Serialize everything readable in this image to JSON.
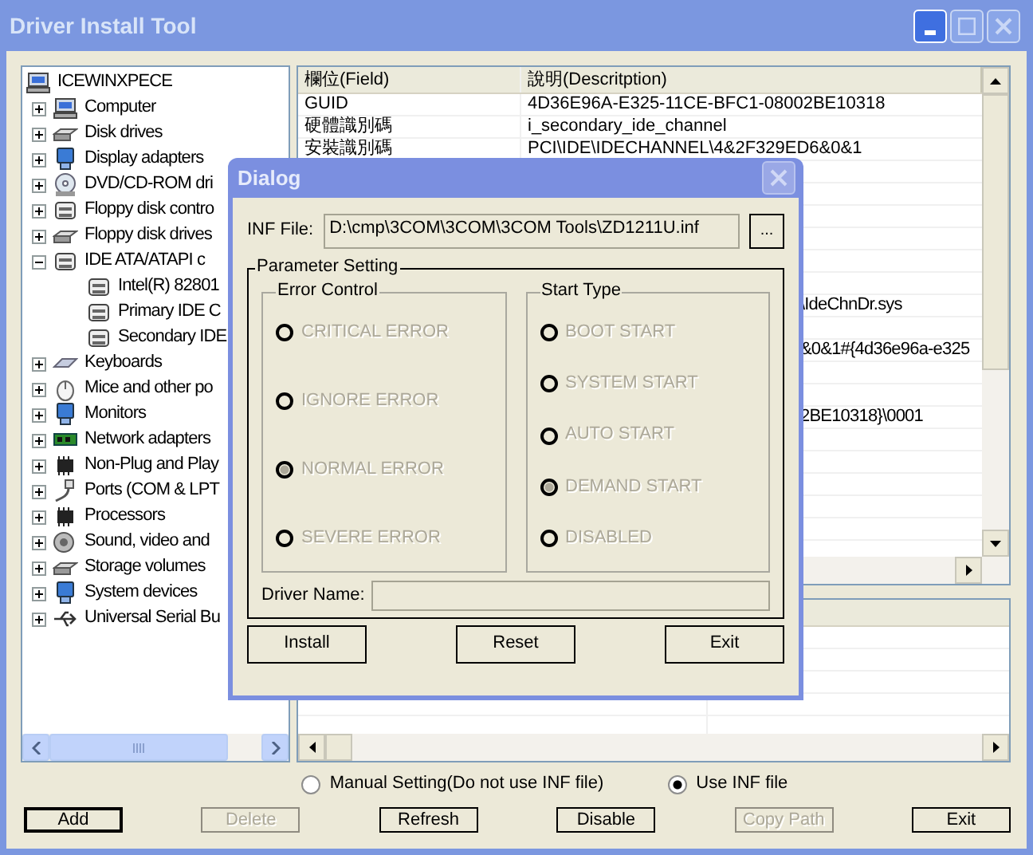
{
  "window": {
    "title": "Driver Install Tool"
  },
  "tree": {
    "label": "ICEWINXPECE",
    "kind": "computer",
    "items": [
      {
        "label": "Computer",
        "kind": "computer",
        "expanded": false
      },
      {
        "label": "Disk drives",
        "kind": "drive",
        "expanded": false
      },
      {
        "label": "Display adapters",
        "kind": "monitor",
        "expanded": false
      },
      {
        "label": "DVD/CD-ROM dri",
        "kind": "disc",
        "expanded": false
      },
      {
        "label": "Floppy disk contro",
        "kind": "controller",
        "expanded": false
      },
      {
        "label": "Floppy disk drives",
        "kind": "drive",
        "expanded": false
      },
      {
        "label": "IDE ATA/ATAPI c",
        "kind": "controller",
        "expanded": true,
        "children": [
          {
            "label": "Intel(R) 82801",
            "kind": "controller"
          },
          {
            "label": "Primary IDE C",
            "kind": "controller"
          },
          {
            "label": "Secondary IDE",
            "kind": "controller"
          }
        ]
      },
      {
        "label": "Keyboards",
        "kind": "keyboard",
        "expanded": false
      },
      {
        "label": "Mice and other po",
        "kind": "mouse",
        "expanded": false
      },
      {
        "label": "Monitors",
        "kind": "monitor",
        "expanded": false
      },
      {
        "label": "Network adapters",
        "kind": "network",
        "expanded": false
      },
      {
        "label": "Non-Plug and Play",
        "kind": "chip",
        "expanded": false
      },
      {
        "label": "Ports (COM & LPT",
        "kind": "port",
        "expanded": false
      },
      {
        "label": "Processors",
        "kind": "chip",
        "expanded": false
      },
      {
        "label": "Sound, video and",
        "kind": "sound",
        "expanded": false
      },
      {
        "label": "Storage volumes",
        "kind": "drive",
        "expanded": false
      },
      {
        "label": "System devices",
        "kind": "monitor",
        "expanded": false
      },
      {
        "label": "Universal Serial Bu",
        "kind": "usb",
        "expanded": false
      }
    ]
  },
  "properties": {
    "columns": [
      "欄位(Field)",
      "說明(Descritption)"
    ],
    "rows": [
      {
        "kind": "full",
        "field": "GUID",
        "description": "4D36E96A-E325-11CE-BFC1-08002BE10318"
      },
      {
        "kind": "full",
        "field": "硬體識別碼",
        "description": "i_secondary_ide_channel"
      },
      {
        "kind": "full",
        "field": "安裝識別碼",
        "description": "PCI\\IDE\\IDECHANNEL\\4&2F329ED6&0&1"
      },
      {
        "kind": "covered"
      },
      {
        "kind": "covered"
      },
      {
        "kind": "covered"
      },
      {
        "kind": "covered"
      },
      {
        "kind": "covered"
      },
      {
        "kind": "covered"
      },
      {
        "kind": "partial",
        "description": "\\IdeChnDr.sys"
      },
      {
        "kind": "covered"
      },
      {
        "kind": "partial",
        "description": "&0&1#{4d36e96a-e325"
      },
      {
        "kind": "covered"
      },
      {
        "kind": "covered"
      },
      {
        "kind": "partial",
        "description": "2BE10318}\\0001"
      }
    ]
  },
  "mode_options": [
    {
      "label": "Manual Setting(Do not use INF file)",
      "selected": false
    },
    {
      "label": "Use INF file",
      "selected": true
    }
  ],
  "buttons": [
    {
      "label": "Add",
      "default": true,
      "disabled": false
    },
    {
      "label": "Delete",
      "default": false,
      "disabled": true
    },
    {
      "label": "Refresh",
      "default": false,
      "disabled": false
    },
    {
      "label": "Disable",
      "default": false,
      "disabled": false
    },
    {
      "label": "Copy Path",
      "default": false,
      "disabled": true
    },
    {
      "label": "Exit",
      "default": false,
      "disabled": false
    }
  ],
  "dialog": {
    "title": "Dialog",
    "inf_label": "INF File:",
    "inf_value": "D:\\cmp\\3COM\\3COM\\3COM Tools\\ZD1211U.inf",
    "browse": "...",
    "group_title": "Parameter Setting",
    "error_control": {
      "title": "Error Control",
      "disabled": true,
      "options": [
        {
          "label": "CRITICAL ERROR",
          "selected": false
        },
        {
          "label": "IGNORE ERROR",
          "selected": false
        },
        {
          "label": "NORMAL ERROR",
          "selected": true
        },
        {
          "label": "SEVERE ERROR",
          "selected": false
        }
      ]
    },
    "start_type": {
      "title": "Start Type",
      "disabled": true,
      "options": [
        {
          "label": "BOOT START",
          "selected": false
        },
        {
          "label": "SYSTEM START",
          "selected": false
        },
        {
          "label": "AUTO START",
          "selected": false
        },
        {
          "label": "DEMAND START",
          "selected": true
        },
        {
          "label": "DISABLED",
          "selected": false
        }
      ]
    },
    "driver_name_label": "Driver Name:",
    "buttons": [
      "Install",
      "Reset",
      "Exit"
    ]
  }
}
